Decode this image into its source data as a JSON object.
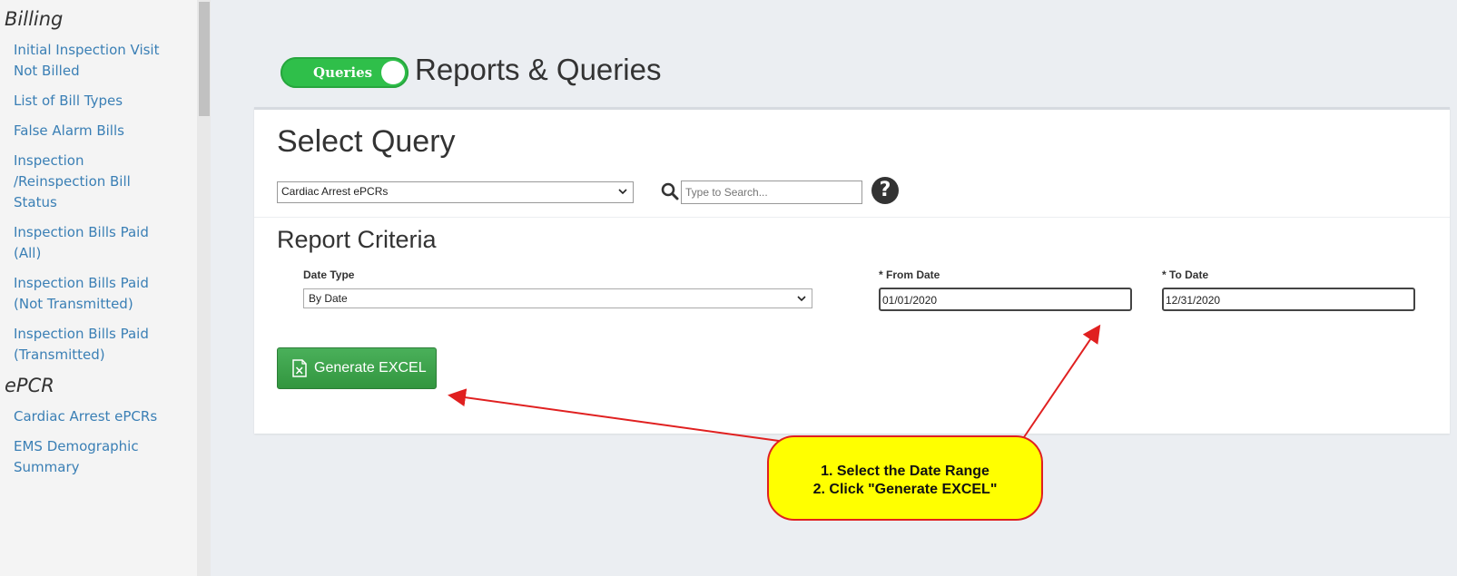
{
  "sidebar": {
    "sections": [
      {
        "title": "Billing",
        "items": [
          "Initial Inspection Visit Not Billed",
          "List of Bill Types",
          "False Alarm Bills",
          "Inspection /Reinspection Bill Status",
          "Inspection Bills Paid (All)",
          "Inspection Bills Paid (Not Transmitted)",
          "Inspection Bills Paid (Transmitted)"
        ]
      },
      {
        "title": "ePCR",
        "items": [
          "Cardiac Arrest ePCRs",
          "EMS Demographic Summary"
        ]
      }
    ]
  },
  "header": {
    "toggle_label": "Queries",
    "title": "Reports & Queries"
  },
  "query": {
    "title": "Select Query",
    "selected": "Cardiac Arrest ePCRs",
    "search_placeholder": "Type to Search...",
    "help_glyph": "?"
  },
  "criteria": {
    "title": "Report Criteria",
    "date_type_label": "Date Type",
    "date_type_value": "By Date",
    "from_label": "* From Date",
    "from_value": "01/01/2020",
    "to_label": "* To Date",
    "to_value": "12/31/2020"
  },
  "actions": {
    "generate_label": "Generate EXCEL"
  },
  "annotation": {
    "line1": "1. Select the Date Range",
    "line2": "2. Click \"Generate EXCEL\""
  },
  "colors": {
    "link": "#3a7fb5",
    "toggle": "#2fbf4a",
    "button": "#3ea34d",
    "callout_fill": "#ffff00",
    "callout_border": "#e02020"
  }
}
